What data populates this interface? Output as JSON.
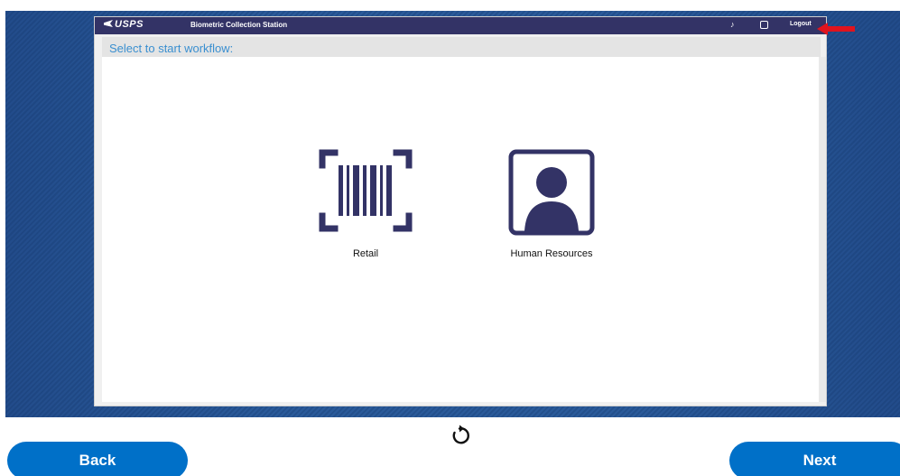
{
  "header": {
    "logo_text": "USPS",
    "app_name": "Biometric Collection Station",
    "logout_label": "Logout"
  },
  "main": {
    "prompt": "Select to start workflow:",
    "tiles": [
      {
        "label": "Retail",
        "icon": "barcode-icon"
      },
      {
        "label": "Human Resources",
        "icon": "person-icon"
      }
    ]
  },
  "footer": {
    "back_label": "Back",
    "next_label": "Next"
  },
  "colors": {
    "titlebar": "#333366",
    "icon": "#333366",
    "accent": "#0070c8",
    "prompt_text": "#3a8fd0",
    "annotation_arrow": "#e0141e"
  }
}
